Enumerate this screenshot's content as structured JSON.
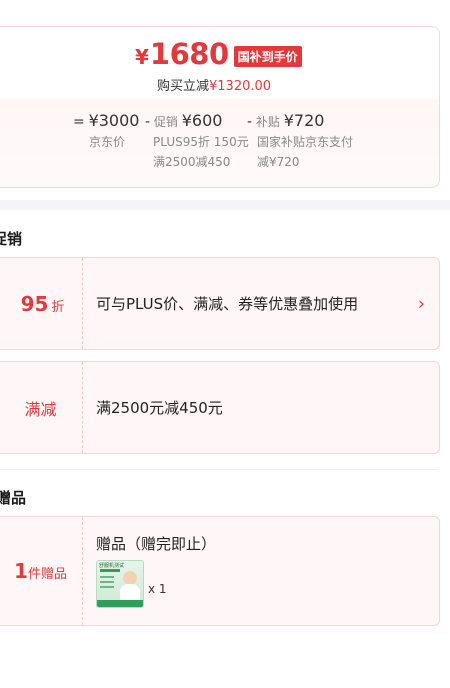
{
  "price": {
    "currency": "¥",
    "final_amount": "1680",
    "subsidy_tag": "国补到手价",
    "reduce_label": "购买立减",
    "reduce_value": "¥1320.00"
  },
  "calc": {
    "eq": "=",
    "jd_price": "¥3000",
    "jd_price_label": "京东价",
    "minus1": "-",
    "promo_label": "促销",
    "promo_value": "¥600",
    "promo_detail1": "PLUS95折 150元",
    "promo_detail2": "满2500减450",
    "minus2": "-",
    "subsidy_label": "补贴",
    "subsidy_value": "¥720",
    "subsidy_detail1": "国家补贴京东支付",
    "subsidy_detail2": "减¥720"
  },
  "promotions": {
    "title": "促销",
    "plus": {
      "num": "95",
      "unit": "折",
      "text": "可与PLUS价、满减、券等优惠叠加使用"
    },
    "manjian": {
      "label": "满减",
      "text": "满2500元减450元"
    }
  },
  "gifts": {
    "title": "赠品",
    "count": "1",
    "count_unit": "件赠品",
    "heading": "赠品（赠完即止）",
    "qty": "x 1",
    "thumb_caption": "舒服机测试"
  },
  "colors": {
    "accent": "#e4393c",
    "card_bg": "#fff7f7",
    "border": "#f3d6d6"
  }
}
